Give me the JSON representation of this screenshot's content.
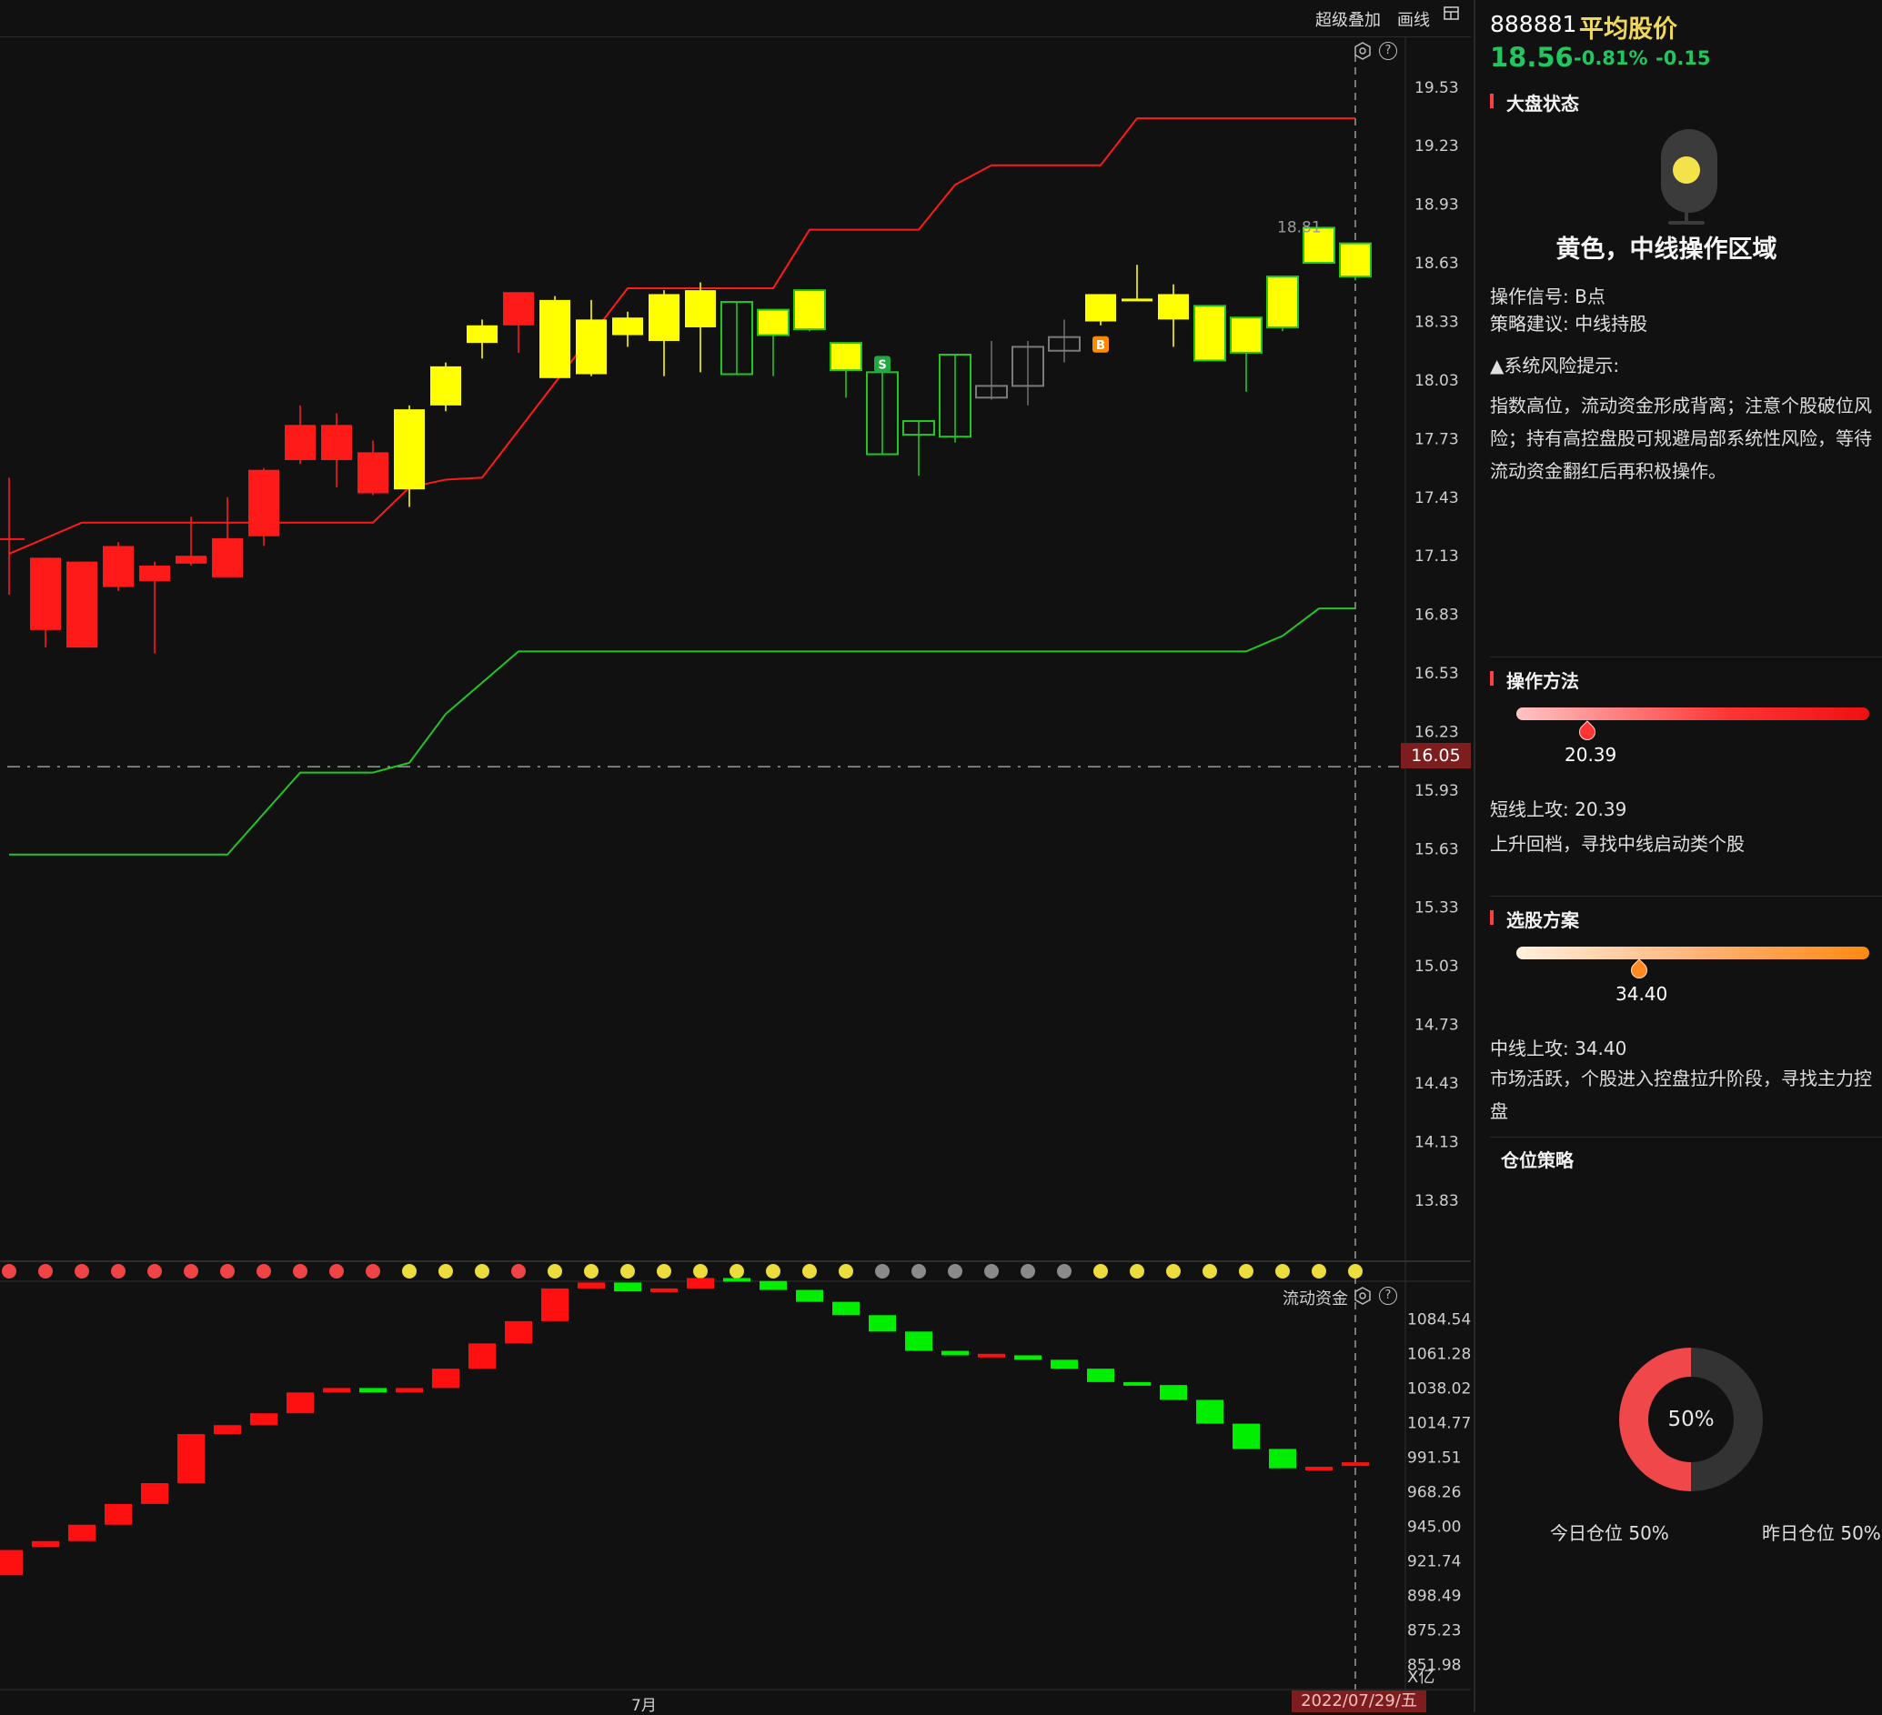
{
  "toolbar": {
    "overlay": "超级叠加",
    "draw": "画线",
    "grid_icon": "grid-icon",
    "settings_icon": "hexagon-settings-icon",
    "help_icon": "help-icon"
  },
  "colors": {
    "up": "#ff1a1a",
    "down_fill": "#ffff00",
    "down_border": "#22c522",
    "resistance": "#ff1a1a",
    "support": "#22c522",
    "background": "#111111"
  },
  "chart_data": {
    "type": "candlestick",
    "price_axis": {
      "ticks": [
        "19.53",
        "19.23",
        "18.93",
        "18.63",
        "18.33",
        "18.03",
        "17.73",
        "17.43",
        "17.13",
        "16.83",
        "16.53",
        "16.23",
        "15.93",
        "15.63",
        "15.33",
        "15.03",
        "14.73",
        "14.43",
        "14.13",
        "13.83"
      ],
      "range": [
        13.55,
        19.72
      ]
    },
    "current_line": "16.05",
    "high_label": "18.81",
    "candles": [
      {
        "o": 17.22,
        "h": 17.53,
        "l": 16.93,
        "c": 17.22,
        "k": "red"
      },
      {
        "o": 17.12,
        "h": 17.12,
        "l": 16.66,
        "c": 16.75,
        "k": "red"
      },
      {
        "o": 17.1,
        "h": 17.1,
        "l": 16.66,
        "c": 16.66,
        "k": "red"
      },
      {
        "o": 17.18,
        "h": 17.2,
        "l": 16.95,
        "c": 16.97,
        "k": "red"
      },
      {
        "o": 17.08,
        "h": 17.1,
        "l": 16.63,
        "c": 17.0,
        "k": "red"
      },
      {
        "o": 17.13,
        "h": 17.33,
        "l": 17.08,
        "c": 17.09,
        "k": "red"
      },
      {
        "o": 17.22,
        "h": 17.43,
        "l": 17.07,
        "c": 17.02,
        "k": "red"
      },
      {
        "o": 17.57,
        "h": 17.58,
        "l": 17.18,
        "c": 17.23,
        "k": "red"
      },
      {
        "o": 17.8,
        "h": 17.9,
        "l": 17.6,
        "c": 17.62,
        "k": "red"
      },
      {
        "o": 17.8,
        "h": 17.86,
        "l": 17.48,
        "c": 17.62,
        "k": "red"
      },
      {
        "o": 17.66,
        "h": 17.72,
        "l": 17.44,
        "c": 17.45,
        "k": "red"
      },
      {
        "o": 17.88,
        "h": 17.9,
        "l": 17.38,
        "c": 17.47,
        "k": "yellow"
      },
      {
        "o": 18.1,
        "h": 18.12,
        "l": 17.87,
        "c": 17.9,
        "k": "yellow"
      },
      {
        "o": 18.31,
        "h": 18.34,
        "l": 18.14,
        "c": 18.22,
        "k": "yellow"
      },
      {
        "o": 18.48,
        "h": 18.48,
        "l": 18.17,
        "c": 18.31,
        "k": "red"
      },
      {
        "o": 18.44,
        "h": 18.46,
        "l": 18.04,
        "c": 18.04,
        "k": "yellow"
      },
      {
        "o": 18.34,
        "h": 18.44,
        "l": 18.05,
        "c": 18.06,
        "k": "yellow"
      },
      {
        "o": 18.35,
        "h": 18.38,
        "l": 18.2,
        "c": 18.26,
        "k": "yellow"
      },
      {
        "o": 18.47,
        "h": 18.49,
        "l": 18.05,
        "c": 18.23,
        "k": "yellow"
      },
      {
        "o": 18.49,
        "h": 18.53,
        "l": 18.07,
        "c": 18.3,
        "k": "yellow"
      },
      {
        "o": 18.43,
        "h": 18.43,
        "l": 18.06,
        "c": 18.06,
        "k": "green_hollow"
      },
      {
        "o": 18.39,
        "h": 18.39,
        "l": 18.05,
        "c": 18.26,
        "k": "yellow_green"
      },
      {
        "o": 18.49,
        "h": 18.49,
        "l": 18.28,
        "c": 18.29,
        "k": "yellow_green"
      },
      {
        "o": 18.22,
        "h": 18.22,
        "l": 17.94,
        "c": 18.08,
        "k": "yellow_green"
      },
      {
        "o": 18.07,
        "h": 18.07,
        "l": 17.65,
        "c": 17.65,
        "k": "green_hollow"
      },
      {
        "o": 17.82,
        "h": 17.82,
        "l": 17.54,
        "c": 17.75,
        "k": "green_hollow"
      },
      {
        "o": 18.16,
        "h": 18.16,
        "l": 17.71,
        "c": 17.74,
        "k": "green_hollow"
      },
      {
        "o": 18.0,
        "h": 18.23,
        "l": 17.93,
        "c": 17.94,
        "k": "gray_hollow"
      },
      {
        "o": 18.2,
        "h": 18.23,
        "l": 17.9,
        "c": 18.0,
        "k": "gray_hollow"
      },
      {
        "o": 18.25,
        "h": 18.34,
        "l": 18.12,
        "c": 18.18,
        "k": "gray_hollow"
      },
      {
        "o": 18.47,
        "h": 18.47,
        "l": 18.31,
        "c": 18.33,
        "k": "yellow"
      },
      {
        "o": 18.44,
        "h": 18.62,
        "l": 18.44,
        "c": 18.44,
        "k": "yellow_doji"
      },
      {
        "o": 18.47,
        "h": 18.52,
        "l": 18.2,
        "c": 18.34,
        "k": "yellow"
      },
      {
        "o": 18.41,
        "h": 18.41,
        "l": 18.13,
        "c": 18.13,
        "k": "yellow_green"
      },
      {
        "o": 18.35,
        "h": 18.35,
        "l": 17.97,
        "c": 18.17,
        "k": "yellow_green"
      },
      {
        "o": 18.56,
        "h": 18.56,
        "l": 18.28,
        "c": 18.3,
        "k": "yellow_green"
      },
      {
        "o": 18.81,
        "h": 18.81,
        "l": 18.63,
        "c": 18.63,
        "k": "yellow_green"
      },
      {
        "o": 18.73,
        "h": 18.73,
        "l": 18.54,
        "c": 18.56,
        "k": "yellow_green"
      }
    ],
    "resistance_line": [
      [
        0,
        17.14
      ],
      [
        2,
        17.3
      ],
      [
        3,
        17.3
      ],
      [
        10,
        17.3
      ],
      [
        11,
        17.48
      ],
      [
        12,
        17.52
      ],
      [
        13,
        17.53
      ],
      [
        17,
        18.5
      ],
      [
        21,
        18.5
      ],
      [
        22,
        18.8
      ],
      [
        25,
        18.8
      ],
      [
        26,
        19.03
      ],
      [
        27,
        19.13
      ],
      [
        30,
        19.13
      ],
      [
        31,
        19.37
      ],
      [
        37,
        19.37
      ]
    ],
    "support_line": [
      [
        0,
        15.6
      ],
      [
        6,
        15.6
      ],
      [
        8,
        16.02
      ],
      [
        10,
        16.02
      ],
      [
        11,
        16.07
      ],
      [
        12,
        16.32
      ],
      [
        14,
        16.64
      ],
      [
        34,
        16.64
      ],
      [
        35,
        16.72
      ],
      [
        36,
        16.86
      ],
      [
        37,
        16.86
      ]
    ],
    "signal_dots": [
      "red",
      "red",
      "red",
      "red",
      "red",
      "red",
      "red",
      "red",
      "red",
      "red",
      "red",
      "yellow",
      "yellow",
      "yellow",
      "red",
      "yellow",
      "yellow",
      "yellow",
      "yellow",
      "yellow",
      "yellow",
      "yellow",
      "yellow",
      "yellow",
      "gray",
      "gray",
      "gray",
      "gray",
      "gray",
      "gray",
      "yellow",
      "yellow",
      "yellow",
      "yellow",
      "yellow",
      "yellow",
      "yellow",
      "yellow"
    ],
    "markers": [
      {
        "i": 24,
        "text": "S",
        "color": "#22a840"
      },
      {
        "i": 30,
        "text": "B",
        "color": "#ff8a00"
      }
    ],
    "sub_title": "流动资金",
    "sub_axis": {
      "ticks": [
        "1084.54",
        "1061.28",
        "1038.02",
        "1014.77",
        "991.51",
        "968.26",
        "945.00",
        "921.74",
        "898.49",
        "875.23",
        "851.98"
      ],
      "unit": "X亿",
      "range": [
        840,
        1108
      ]
    },
    "flow_bars": [
      {
        "o": 929,
        "c": 912,
        "k": "red"
      },
      {
        "o": 935,
        "c": 931,
        "k": "red"
      },
      {
        "o": 946,
        "c": 935,
        "k": "red"
      },
      {
        "o": 960,
        "c": 946,
        "k": "red"
      },
      {
        "o": 974,
        "c": 960,
        "k": "red"
      },
      {
        "o": 1007,
        "c": 974,
        "k": "red"
      },
      {
        "o": 1013,
        "c": 1007,
        "k": "red"
      },
      {
        "o": 1021,
        "c": 1013,
        "k": "red"
      },
      {
        "o": 1035,
        "c": 1021,
        "k": "red"
      },
      {
        "o": 1038,
        "c": 1035,
        "k": "red"
      },
      {
        "o": 1035,
        "c": 1038,
        "k": "green"
      },
      {
        "o": 1038,
        "c": 1035,
        "k": "red"
      },
      {
        "o": 1051,
        "c": 1038,
        "k": "red"
      },
      {
        "o": 1068,
        "c": 1051,
        "k": "red"
      },
      {
        "o": 1083,
        "c": 1068,
        "k": "red"
      },
      {
        "o": 1105,
        "c": 1083,
        "k": "red"
      },
      {
        "o": 1109,
        "c": 1105,
        "k": "red"
      },
      {
        "o": 1103,
        "c": 1109,
        "k": "green"
      },
      {
        "o": 1105,
        "c": 1103,
        "k": "red"
      },
      {
        "o": 1112,
        "c": 1105,
        "k": "red"
      },
      {
        "o": 1110,
        "c": 1112,
        "k": "green"
      },
      {
        "o": 1104,
        "c": 1110,
        "k": "green"
      },
      {
        "o": 1096,
        "c": 1104,
        "k": "green"
      },
      {
        "o": 1087,
        "c": 1096,
        "k": "green"
      },
      {
        "o": 1076,
        "c": 1087,
        "k": "green"
      },
      {
        "o": 1063,
        "c": 1076,
        "k": "green"
      },
      {
        "o": 1060,
        "c": 1063,
        "k": "green"
      },
      {
        "o": 1059,
        "c": 1061,
        "k": "red"
      },
      {
        "o": 1057,
        "c": 1060,
        "k": "green"
      },
      {
        "o": 1051,
        "c": 1057,
        "k": "green"
      },
      {
        "o": 1042,
        "c": 1051,
        "k": "green"
      },
      {
        "o": 1040,
        "c": 1042,
        "k": "green"
      },
      {
        "o": 1030,
        "c": 1040,
        "k": "green"
      },
      {
        "o": 1014,
        "c": 1030,
        "k": "green"
      },
      {
        "o": 997,
        "c": 1014,
        "k": "green"
      },
      {
        "o": 984,
        "c": 997,
        "k": "green"
      },
      {
        "o": 983,
        "c": 985,
        "k": "red"
      },
      {
        "o": 986,
        "c": 988,
        "k": "red"
      }
    ],
    "x_axis": {
      "month_label": "7月",
      "cursor_date": "2022/07/29/五"
    }
  },
  "panel": {
    "code": "888881",
    "name": "平均股价",
    "price": "18.56",
    "pct": "-0.81%",
    "change": "-0.15",
    "market_state": {
      "title": "大盘状态",
      "lamp_color": "#f4e24a",
      "status": "黄色，中线操作区域",
      "signal": "操作信号: B点",
      "advice": "策略建议: 中线持股",
      "risk_title": "▲系统风险提示:",
      "risk_lines": [
        "指数高位，流动资金形成背离；注意个股破位风",
        "险；持有高控盘股可规避局部系统性风险，等待",
        "流动资金翻红后再积极操作。"
      ]
    },
    "method": {
      "title": "操作方法",
      "value": "20.39",
      "level": 0.2,
      "line1": "短线上攻: 20.39",
      "line2": "上升回档，寻找中线启动类个股"
    },
    "selection": {
      "title": "选股方案",
      "value": "34.40",
      "level": 0.35,
      "line1": "中线上攻: 34.40",
      "lines": [
        "市场活跃，个股进入控盘拉升阶段，寻找主力控",
        "盘"
      ]
    },
    "position": {
      "title": "仓位策略",
      "percent": 0.5,
      "center": "50%",
      "today": "今日仓位  50%",
      "yesterday": "昨日仓位  50%"
    }
  }
}
